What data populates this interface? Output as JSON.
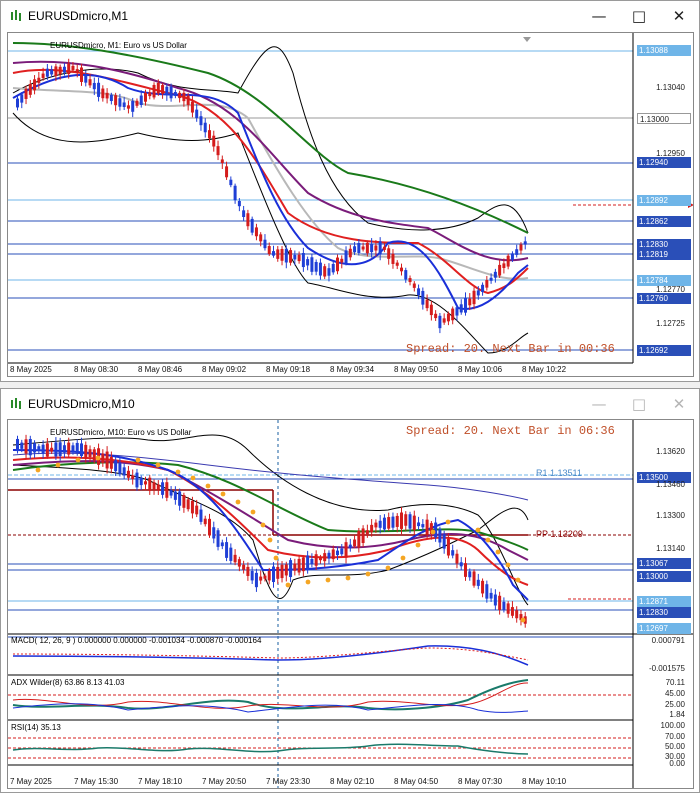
{
  "windows": [
    {
      "title": "EURUSDmicro,M1",
      "symbol_label": "EURUSDmicro, M1:  Euro vs US Dollar",
      "overlay": "Spread: 20. Next Bar in 00:36",
      "price_labels": [
        "1.13088",
        "1.13040",
        "1.13000",
        "1.12950",
        "1.12940",
        "1.12892",
        "1.12862",
        "1.12830",
        "1.12819",
        "1.12784",
        "1.12770",
        "1.12760",
        "1.12725",
        "1.12692"
      ],
      "time_labels": [
        "8 May 2025",
        "8 May 08:30",
        "8 May 08:46",
        "8 May 09:02",
        "8 May 09:18",
        "8 May 09:34",
        "8 May 09:50",
        "8 May 10:06",
        "8 May 10:22"
      ]
    },
    {
      "title": "EURUSDmicro,M10",
      "symbol_label": "EURUSDmicro, M10:  Euro vs US Dollar",
      "overlay": "Spread: 20. Next Bar in 06:36",
      "pivot_r1": "R1 1.13511",
      "pivot_pp": "PP 1.13209",
      "price_labels": [
        "1.13620",
        "1.13500",
        "1.13460",
        "1.13300",
        "1.13140",
        "1.13067",
        "1.13000",
        "1.12871",
        "1.12830",
        "1.12697"
      ],
      "time_labels": [
        "7 May 2025",
        "7 May 15:30",
        "7 May 18:10",
        "7 May 20:50",
        "7 May 23:30",
        "8 May 02:10",
        "8 May 04:50",
        "8 May 07:30",
        "8 May 10:10"
      ],
      "macd_label": "MACD( 12, 26, 9 ) 0.000000 0.000000 -0.001034 -0.000870 -0.000164",
      "macd_scale": [
        "0.000791",
        "-0.001575"
      ],
      "adx_label": "ADX Wilder(8) 63.86 8.13 41.03",
      "adx_scale": [
        "70.11",
        "45.00",
        "25.00",
        "1.84"
      ],
      "rsi_label": "RSI(14) 35.13",
      "rsi_scale": [
        "100.00",
        "70.00",
        "50.00",
        "30.00",
        "0.00"
      ]
    }
  ],
  "colors": {
    "candle_up": "#1f3fd6",
    "candle_down": "#d41c1c",
    "ma_fast": "#1a2fd8",
    "ma_mid": "#e02020",
    "ma_slow": "#7a1c7a",
    "ma_long": "#1a7a1a",
    "bands": "#000000",
    "grey_ma": "#b8b8b8",
    "sar": "#f5a623",
    "pivot": "#8b0000",
    "hline": "#2a4fb8",
    "tag_bg": "#2a4fb8",
    "tag_hl": "#6fb5e8",
    "overlay": "#c0502a"
  }
}
